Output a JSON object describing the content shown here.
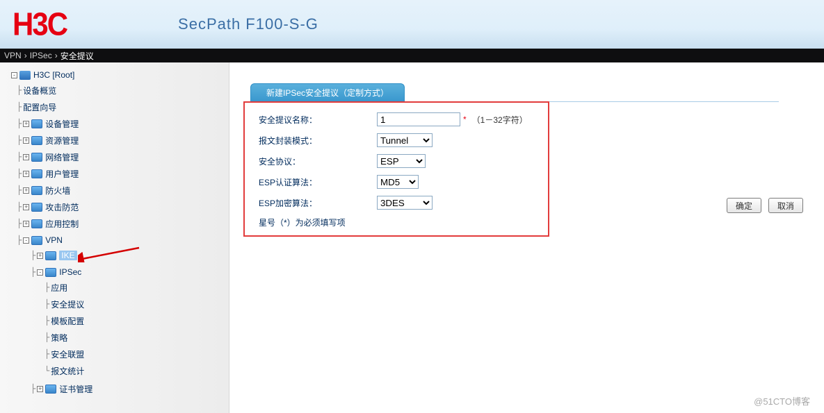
{
  "header": {
    "logo": "H3C",
    "product": "SecPath F100-S-G"
  },
  "breadcrumb": {
    "a": "VPN",
    "b": "IPSec",
    "c": "安全提议"
  },
  "tree": {
    "root": "H3C [Root]",
    "items": {
      "overview": "设备概览",
      "wizard": "配置向导",
      "dev_mgmt": "设备管理",
      "res_mgmt": "资源管理",
      "net_mgmt": "网络管理",
      "user_mgmt": "用户管理",
      "firewall": "防火墙",
      "attack": "攻击防范",
      "app_ctrl": "应用控制",
      "vpn": "VPN",
      "ike": "IKE",
      "ipsec": "IPSec",
      "ipsec_app": "应用",
      "ipsec_prop": "安全提议",
      "ipsec_tmpl": "模板配置",
      "ipsec_policy": "策略",
      "ipsec_sa": "安全联盟",
      "ipsec_stats": "报文统计",
      "cert": "证书管理"
    }
  },
  "tab": {
    "title": "新建IPSec安全提议（定制方式）"
  },
  "form": {
    "name_label": "安全提议名称：",
    "name_value": "1",
    "name_hint": "（1－32字符）",
    "encap_label": "报文封装模式：",
    "encap_value": "Tunnel",
    "proto_label": "安全协议：",
    "proto_value": "ESP",
    "auth_label": "ESP认证算法：",
    "auth_value": "MD5",
    "enc_label": "ESP加密算法：",
    "enc_value": "3DES",
    "note": "星号（*）为必须填写项",
    "star": "*"
  },
  "buttons": {
    "ok": "确定",
    "cancel": "取消"
  },
  "watermark": "@51CTO博客"
}
